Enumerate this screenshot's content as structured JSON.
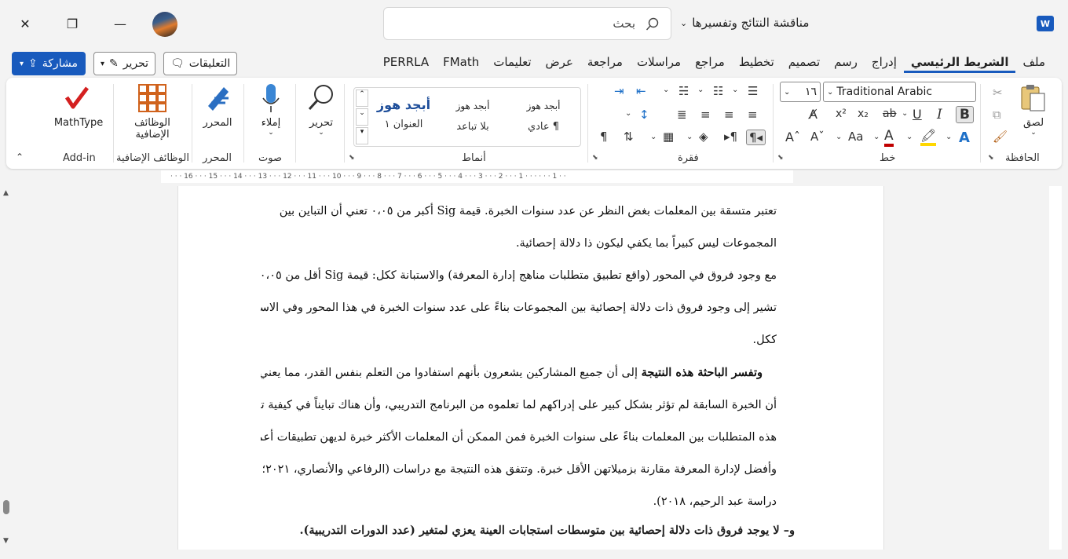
{
  "titlebar": {
    "search_placeholder": "بحث",
    "doc_title": "مناقشة النتائج وتفسيرها",
    "app_logo": "W"
  },
  "tabs": [
    {
      "label": "ملف"
    },
    {
      "label": "الشريط الرئيسي",
      "active": true
    },
    {
      "label": "إدراج"
    },
    {
      "label": "رسم"
    },
    {
      "label": "تصميم"
    },
    {
      "label": "تخطيط"
    },
    {
      "label": "مراجع"
    },
    {
      "label": "مراسلات"
    },
    {
      "label": "مراجعة"
    },
    {
      "label": "عرض"
    },
    {
      "label": "تعليمات"
    },
    {
      "label": "FMath"
    },
    {
      "label": "PERRLA"
    }
  ],
  "actions": {
    "comments": "التعليقات",
    "edit": "تحرير",
    "share": "مشاركة"
  },
  "ribbon": {
    "clipboard": {
      "label": "الحافظة",
      "paste": "لصق"
    },
    "font": {
      "label": "خط",
      "name": "Traditional Arabic",
      "size": "١٦"
    },
    "paragraph": {
      "label": "فقرة"
    },
    "styles": {
      "label": "أنماط",
      "items": [
        {
          "sample": "أبجد هوز",
          "name": "¶ عادي"
        },
        {
          "sample": "أبجد هوز",
          "name": "بلا تباعد"
        },
        {
          "sample": "أبجد هوز",
          "name": "العنوان ١"
        }
      ]
    },
    "editing": {
      "label": "تحرير"
    },
    "voice": {
      "label": "صوت",
      "dictate": "إملاء"
    },
    "editor": {
      "label": "المحرر",
      "button": "المحرر"
    },
    "addins": {
      "label": "الوظائف الإضافية",
      "button_line1": "الوظائف",
      "button_line2": "الإضافية"
    },
    "addin": {
      "label": "Add-in",
      "button": "MathType"
    }
  },
  "document": {
    "lines": [
      "تعتبر متسقة بين المعلمات بغض النظر عن عدد سنوات الخبرة. قيمة Sig أكبر من ٠،٠٥ تعني أن التباين بين",
      "المجموعات ليس كبيراً بما يكفي ليكون ذا دلالة إحصائية.",
      "مع وجود فروق في المحور (واقع تطبيق متطلبات مناهج إدارة المعرفة) والاستبانة ككل: قيمة Sig أقل من ٠،٠٥",
      "تشير إلى وجود فروق ذات دلالة إحصائية بين المجموعات بناءً على عدد سنوات الخبرة في هذا المحور وفي الاستبانة",
      "ككل."
    ],
    "para2_bold": "وتفسر الباحثة هذه النتيجة",
    "para2_rest": " إلى أن جميع المشاركين يشعرون بأنهم استفادوا من التعلم بنفس القدر، مما يعني",
    "para2_lines": [
      "أن الخبرة السابقة لم تؤثر بشكل كبير على إدراكهم لما تعلموه من البرنامج التدريبي، وأن هناك تبايناً في كيفية تطبيق",
      "هذه المتطلبات بين المعلمات بناءً على سنوات الخبرة فمن الممكن أن المعلمات الأكثر خبرة لديهن تطبيقات أعمق",
      "وأفضل لإدارة المعرفة مقارنة بزميلاتهن الأقل خبرة. وتتفق هذه النتيجة مع دراسات (الرفاعي والأنصاري، ٢٠٢١؛",
      "دراسة عبد الرحيم، ٢٠١٨)."
    ],
    "heading": "و– لا يوجد فروق ذات دلالة إحصائية بين متوسطات استجابات العينة يعزي لمتغير (عدد الدورات التدريبية)."
  },
  "colors": {
    "accent": "#185abd",
    "font_color": "#c00000",
    "highlight": "#ffd700"
  }
}
